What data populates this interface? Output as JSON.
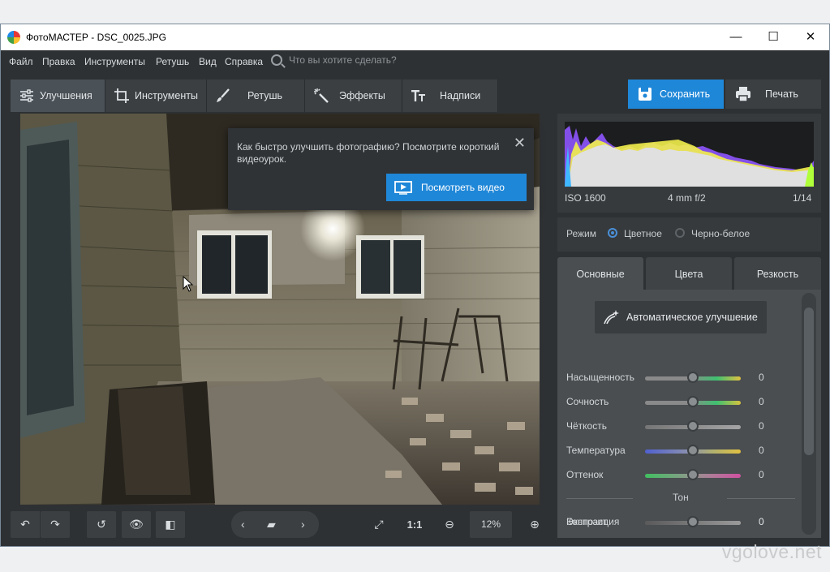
{
  "window": {
    "title": "ФотоМАСТЕР - DSC_0025.JPG",
    "minimize_glyph": "—",
    "maximize_glyph": "☐",
    "close_glyph": "✕"
  },
  "menu": {
    "items": [
      "Файл",
      "Правка",
      "Инструменты",
      "Ретушь",
      "Вид",
      "Справка"
    ],
    "search_placeholder": "Что вы хотите сделать?"
  },
  "tabs": [
    {
      "label": "Улучшения",
      "icon": "sliders-icon",
      "active": true
    },
    {
      "label": "Инструменты",
      "icon": "crop-icon",
      "active": false
    },
    {
      "label": "Ретушь",
      "icon": "brush-icon",
      "active": false
    },
    {
      "label": "Эффекты",
      "icon": "magic-wand-icon",
      "active": false
    },
    {
      "label": "Надписи",
      "icon": "text-icon",
      "active": false
    }
  ],
  "actions": {
    "save_label": "Сохранить",
    "print_label": "Печать"
  },
  "popup": {
    "text": "Как быстро улучшить фотографию? Посмотрите короткий видеоурок.",
    "button_label": "Посмотреть видео",
    "close_glyph": "✕"
  },
  "histogram": {
    "iso": "ISO 1600",
    "lens": "4 mm f/2",
    "shutter": "1/14"
  },
  "mode": {
    "label": "Режим",
    "options": [
      "Цветное",
      "Черно-белое"
    ],
    "selected": "Цветное"
  },
  "subtabs": [
    {
      "label": "Основные",
      "active": true
    },
    {
      "label": "Цвета",
      "active": false
    },
    {
      "label": "Резкость",
      "active": false
    }
  ],
  "adjustments": {
    "auto_label": "Автоматическое улучшение",
    "sliders": [
      {
        "name": "Насыщенность",
        "value": "0"
      },
      {
        "name": "Сочность",
        "value": "0"
      },
      {
        "name": "Чёткость",
        "value": "0"
      },
      {
        "name": "Температура",
        "value": "0"
      },
      {
        "name": "Оттенок",
        "value": "0"
      }
    ],
    "tone_label": "Тон",
    "tone_sliders": [
      {
        "name": "Экспозиция",
        "value": "0"
      },
      {
        "name": "Контраст",
        "value": "0"
      }
    ]
  },
  "bottom": {
    "zoom_ratio": "1:1",
    "zoom_percent": "12%"
  },
  "watermark": "vgolove.net"
}
